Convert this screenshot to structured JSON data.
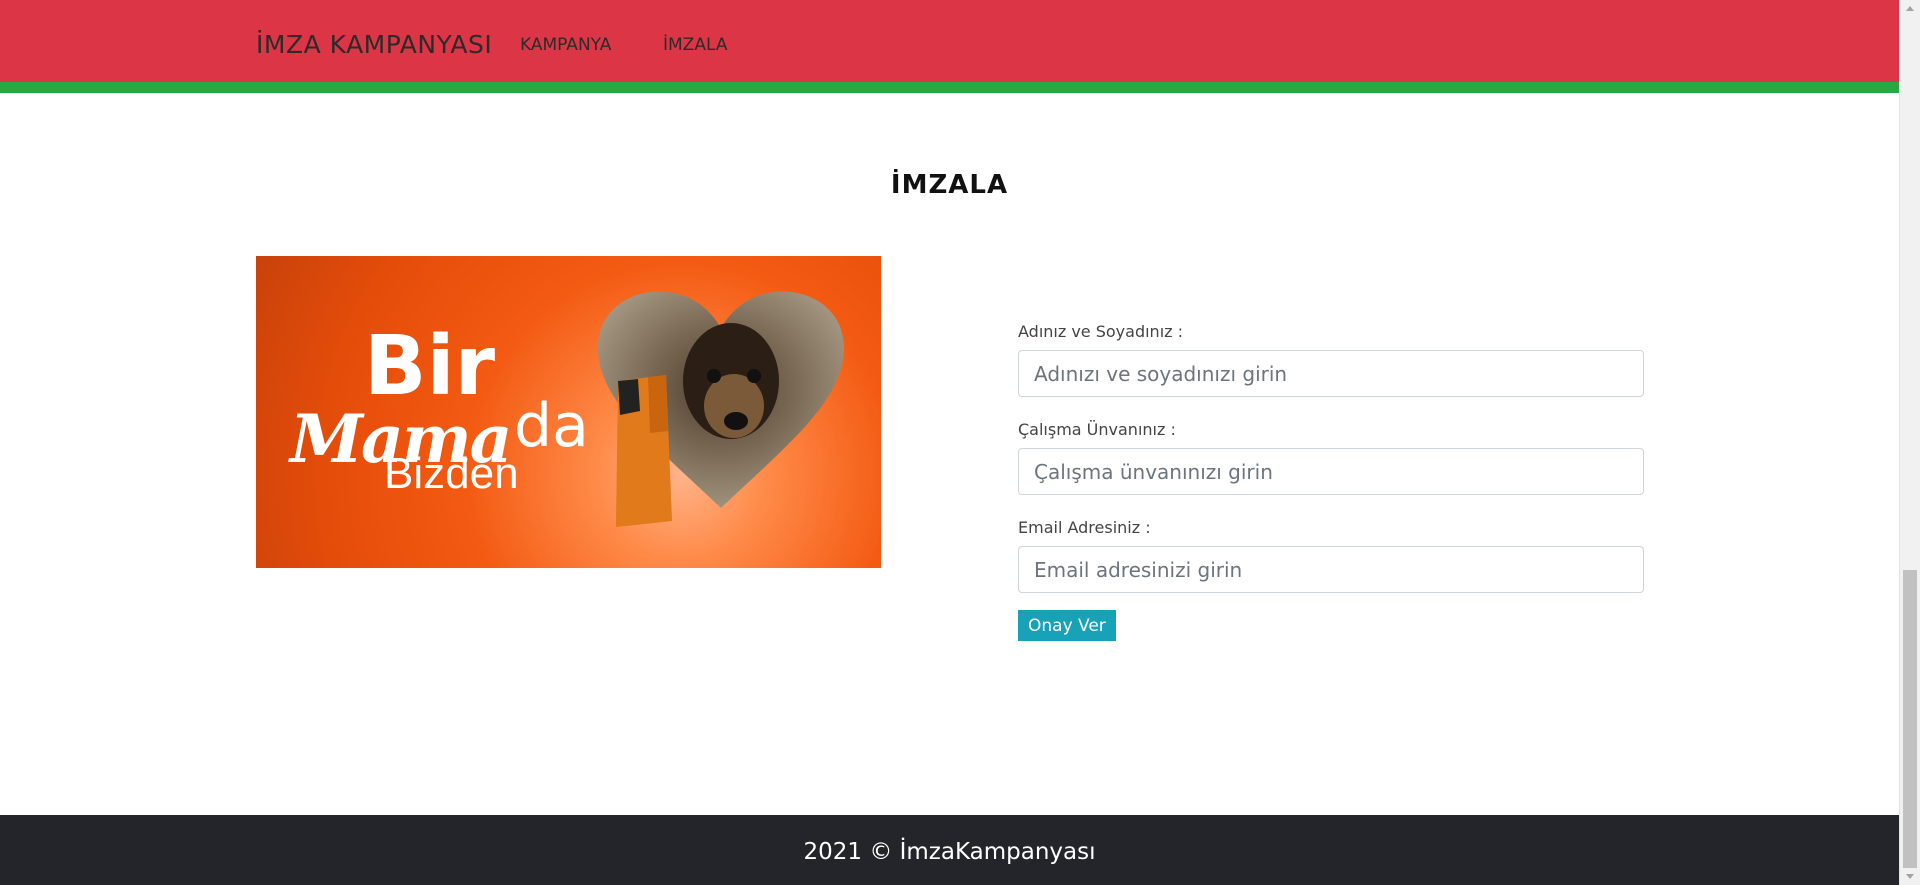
{
  "navbar": {
    "brand": "İMZA KAMPANYASI",
    "links": [
      "KAMPANYA",
      "İMZALA"
    ]
  },
  "section": {
    "title": "İMZALA"
  },
  "banner": {
    "line1": "Bir",
    "line2": "Mama",
    "line3": "da",
    "line4": "Bizden"
  },
  "form": {
    "name_label": "Adınız ve Soyadınız :",
    "name_placeholder": "Adınızı ve soyadınızı girin",
    "title_label": "Çalışma Ünvanınız :",
    "title_placeholder": "Çalışma ünvanınızı girin",
    "email_label": "Email Adresiniz :",
    "email_placeholder": "Email adresinizi girin",
    "submit_label": "Onay Ver"
  },
  "footer": {
    "text": "2021 © İmzaKampanyası"
  },
  "colors": {
    "navbar": "#dc3545",
    "navbar_border": "#28a745",
    "button": "#17a2b8",
    "footer": "#23252b"
  }
}
